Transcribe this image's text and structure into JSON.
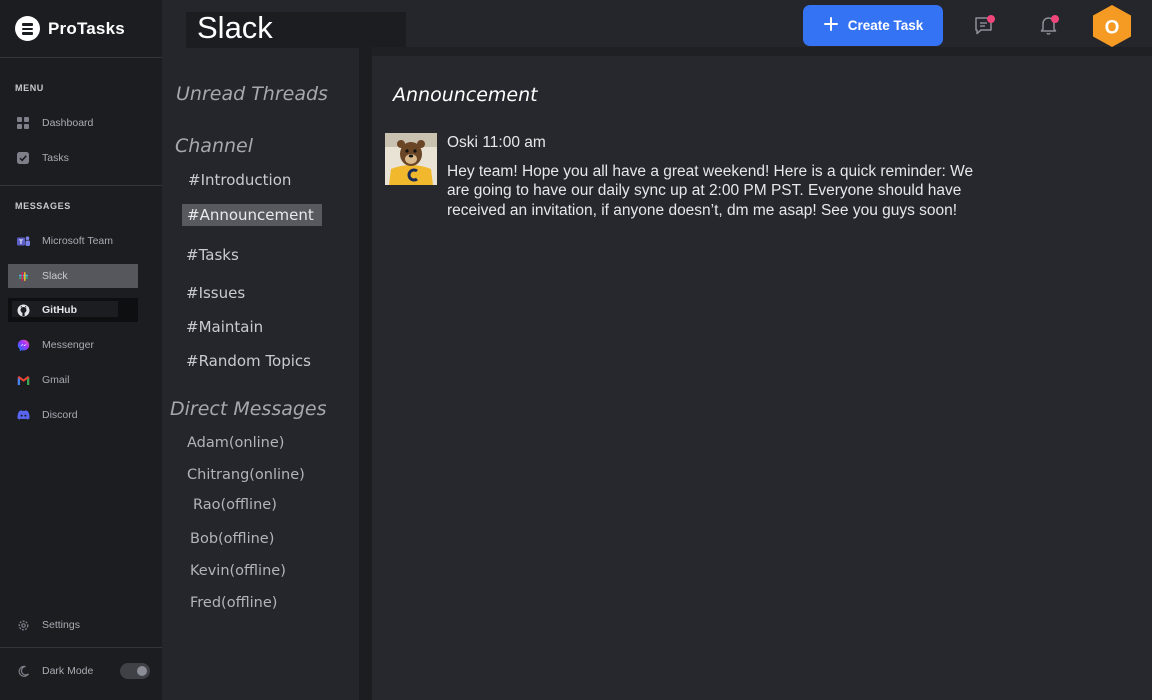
{
  "app": {
    "name": "ProTasks"
  },
  "sidebar": {
    "menu_title": "MENU",
    "menu_items": [
      {
        "label": "Dashboard",
        "icon": "dashboard-icon"
      },
      {
        "label": "Tasks",
        "icon": "tasks-checkbox-icon"
      }
    ],
    "messages_title": "MESSAGES",
    "message_items": [
      {
        "label": "Microsoft Team",
        "icon": "microsoft-teams-icon"
      },
      {
        "label": "Slack",
        "icon": "slack-icon",
        "active": true
      },
      {
        "label": "GitHub",
        "icon": "github-icon"
      },
      {
        "label": "Messenger",
        "icon": "messenger-icon"
      },
      {
        "label": "Gmail",
        "icon": "gmail-icon"
      },
      {
        "label": "Discord",
        "icon": "discord-icon"
      }
    ],
    "settings_label": "Settings",
    "dark_mode_label": "Dark Mode",
    "dark_mode_on": true
  },
  "header": {
    "page_title": "Slack",
    "create_task_label": "Create Task",
    "avatar_initial": "O",
    "colors": {
      "accent": "#3573f5",
      "notification_dot": "#f0457a",
      "avatar": "#f59a23"
    }
  },
  "channels": {
    "unread_threads_label": "Unread Threads",
    "channel_heading": "Channel",
    "channel_list": [
      "#Introduction",
      "#Announcement",
      "#Tasks",
      "#Issues",
      "#Maintain",
      "#Random Topics"
    ],
    "selected_channel": "#Announcement",
    "direct_messages_heading": "Direct Messages",
    "direct_messages": [
      "Adam(online)",
      "Chitrang(online)",
      "Rao(offline)",
      "Bob(offline)",
      "Kevin(offline)",
      "Fred(offline)"
    ]
  },
  "thread": {
    "title": "Announcement",
    "message": {
      "author": "Oski",
      "time": "11:00 am",
      "text": "Hey team! Hope you all have a great weekend! Here is a quick reminder: We are going to have our daily sync up at 2:00 PM PST. Everyone should have received an invitation, if anyone doesn’t, dm me asap! See you guys soon!"
    }
  }
}
